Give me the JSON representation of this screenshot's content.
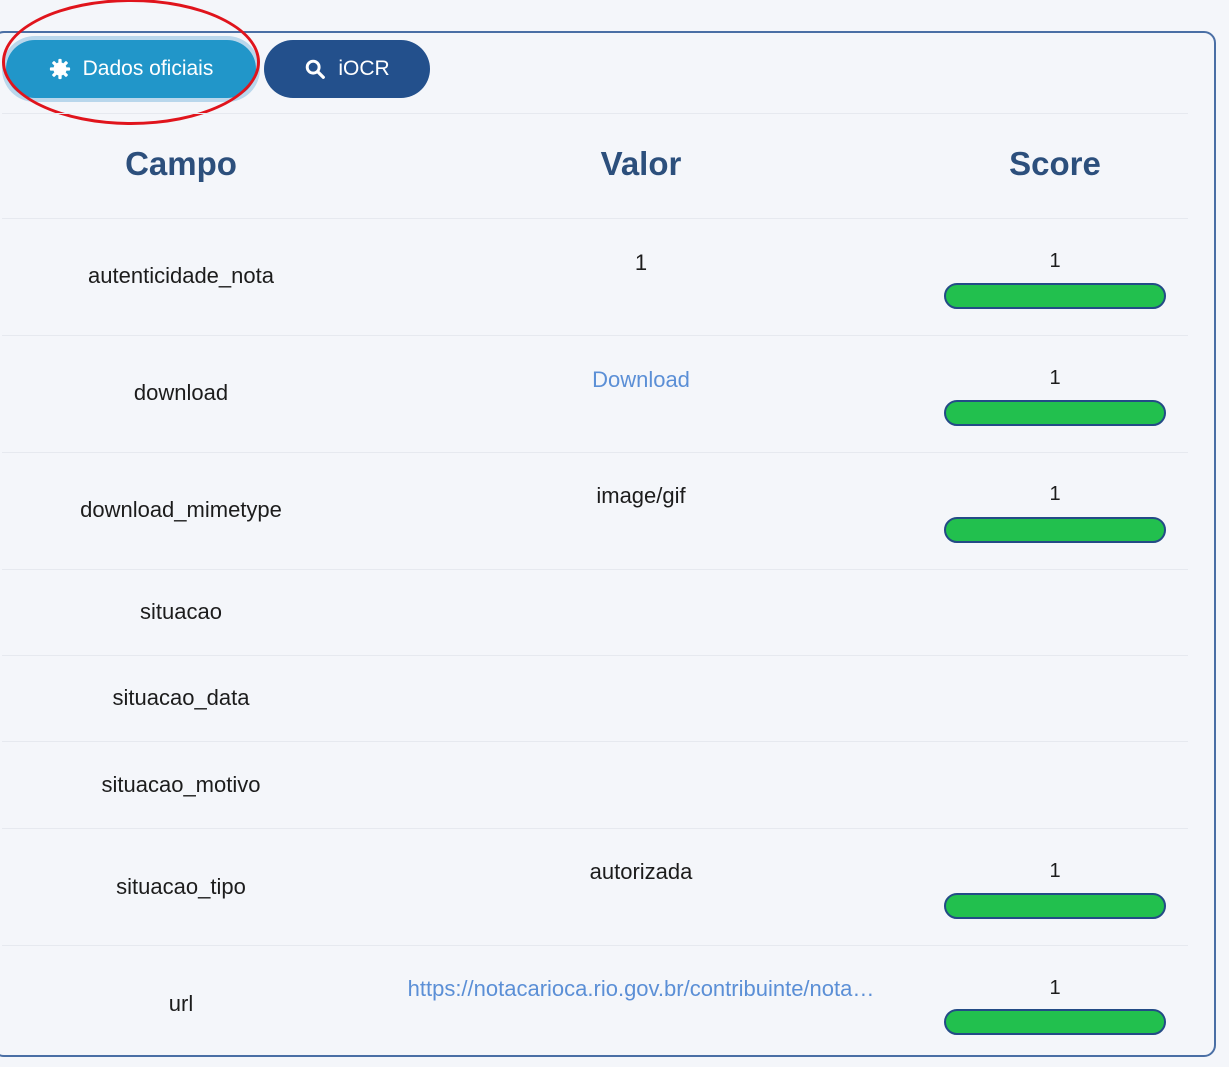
{
  "tabs": {
    "active_label": "Dados oficiais",
    "secondary_label": "iOCR",
    "active_icon": "gear-icon",
    "secondary_icon": "search-icon"
  },
  "colors": {
    "active_tab": "#2196c9",
    "secondary_tab": "#23508c",
    "header_text": "#2c4f7c",
    "link": "#5b8fd6",
    "score_bar_fill": "#22c04e",
    "score_bar_border": "#234b86",
    "highlight_oval": "#e0141c"
  },
  "table": {
    "headers": {
      "campo": "Campo",
      "valor": "Valor",
      "score": "Score"
    },
    "rows": [
      {
        "campo": "autenticidade_nota",
        "valor": "1",
        "valor_is_link": false,
        "score": "1",
        "score_fraction": 1
      },
      {
        "campo": "download",
        "valor": "Download",
        "valor_is_link": true,
        "score": "1",
        "score_fraction": 1
      },
      {
        "campo": "download_mimetype",
        "valor": "image/gif",
        "valor_is_link": false,
        "score": "1",
        "score_fraction": 1
      },
      {
        "campo": "situacao",
        "valor": "",
        "valor_is_link": false,
        "score": "",
        "score_fraction": null
      },
      {
        "campo": "situacao_data",
        "valor": "",
        "valor_is_link": false,
        "score": "",
        "score_fraction": null
      },
      {
        "campo": "situacao_motivo",
        "valor": "",
        "valor_is_link": false,
        "score": "",
        "score_fraction": null
      },
      {
        "campo": "situacao_tipo",
        "valor": "autorizada",
        "valor_is_link": false,
        "score": "1",
        "score_fraction": 1
      },
      {
        "campo": "url",
        "valor": "https://notacarioca.rio.gov.br/contribuinte/nota…",
        "valor_is_link": true,
        "score": "1",
        "score_fraction": 1
      }
    ]
  }
}
